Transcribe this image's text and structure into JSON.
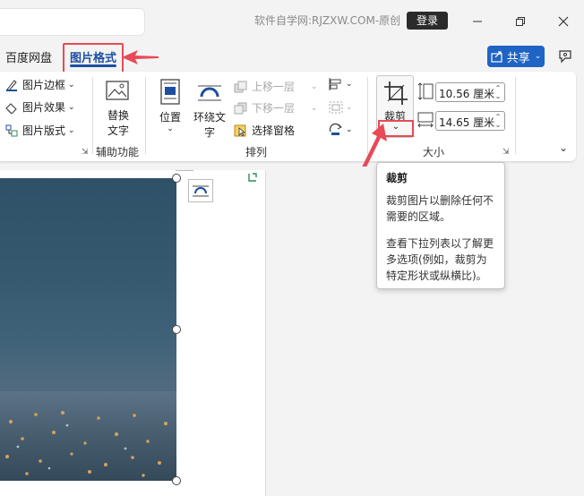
{
  "titlebar": {
    "watermark": "软件自学网:RJZXW.COM-原创",
    "login": "登录"
  },
  "tabs": {
    "baidu": "百度网盘",
    "picture_format": "图片格式",
    "share": "共享"
  },
  "ribbon": {
    "picture_styles": {
      "border": "图片边框",
      "effects": "图片效果",
      "layout": "图片版式"
    },
    "accessibility": {
      "alt_text_line1": "替换",
      "alt_text_line2": "文字",
      "group_label": "辅助功能"
    },
    "arrange": {
      "position": "位置",
      "wrap_text_line1": "环绕文",
      "wrap_text_line2": "字",
      "bring_forward": "上移一层",
      "send_backward": "下移一层",
      "selection_pane": "选择窗格",
      "group_label": "排列"
    },
    "size": {
      "crop": "裁剪",
      "height_value": "10.56 厘米",
      "width_value": "14.65 厘米",
      "group_label": "大小"
    }
  },
  "tooltip": {
    "title": "裁剪",
    "line1": "裁剪图片以删除任何不",
    "line2": "需要的区域。",
    "line3": "查看下拉列表以了解更",
    "line4": "多选项(例如，裁剪为",
    "line5": "特定形状或纵横比)。"
  },
  "colors": {
    "accent": "#1d4fa1",
    "highlight": "#e64b57",
    "share": "#1f63c5"
  }
}
